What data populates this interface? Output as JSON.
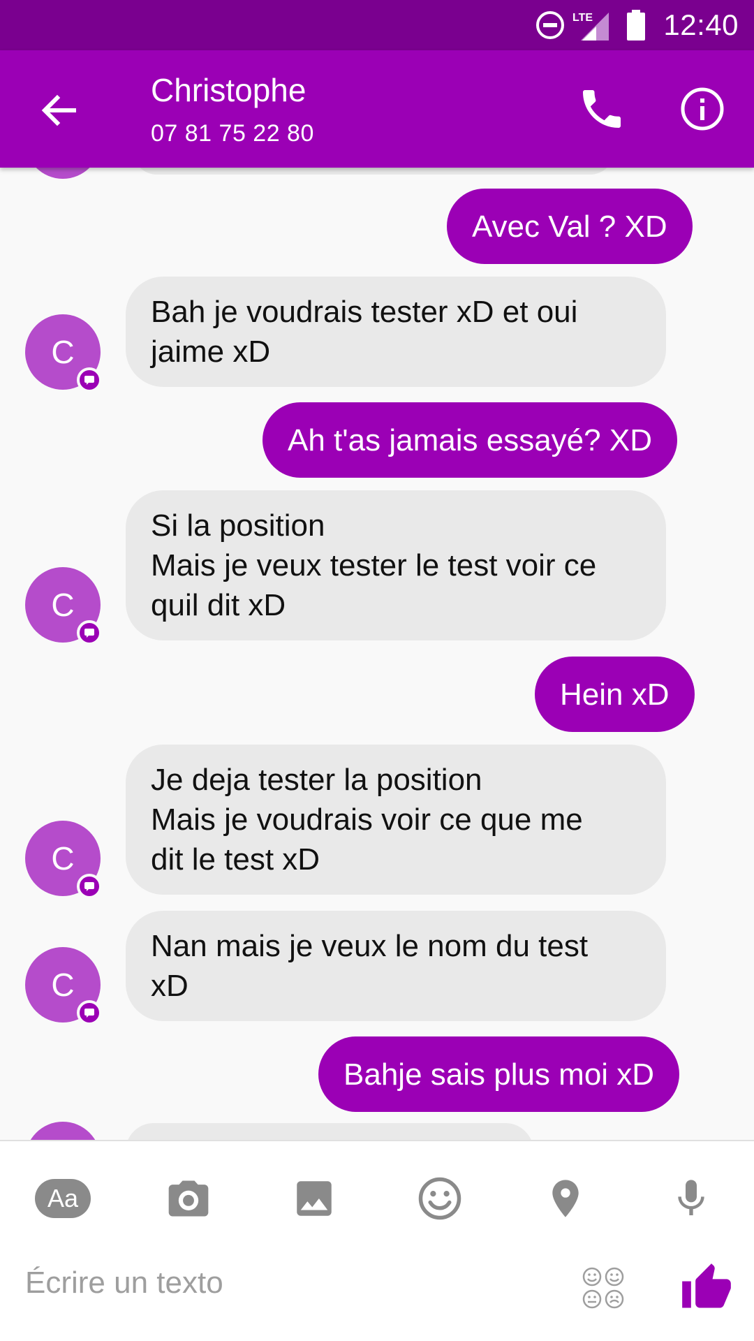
{
  "status_bar": {
    "time": "12:40",
    "network": "LTE"
  },
  "header": {
    "title": "Christophe",
    "subtitle": "07 81 75 22 80"
  },
  "colors": {
    "accent": "#9b00b5",
    "status_bar": "#7a008f",
    "incoming_bubble": "#e9e9e9",
    "avatar": "#b54ccb"
  },
  "messages": [
    {
      "direction": "out",
      "text": "Avec Val ? XD"
    },
    {
      "direction": "in",
      "avatar": "C",
      "text": "Bah je voudrais tester xD et oui\njaime xD"
    },
    {
      "direction": "out",
      "text": "Ah t'as jamais essayé? XD"
    },
    {
      "direction": "in",
      "avatar": "C",
      "text": "Si la position\nMais je veux tester le test voir ce\nquil dit xD"
    },
    {
      "direction": "out",
      "text": "Hein xD"
    },
    {
      "direction": "in",
      "avatar": "C",
      "text": "Je deja tester la position\nMais je voudrais voir ce que me\ndit le test xD"
    },
    {
      "direction": "in",
      "avatar": "C",
      "text": "Nan mais je veux le nom du test\nxD"
    },
    {
      "direction": "out",
      "text": "Bahje sais plus moi xD"
    }
  ],
  "composer": {
    "text_format_label": "Aa",
    "placeholder": "Écrire un texto",
    "tools": [
      "text-format-icon",
      "camera-icon",
      "gallery-icon",
      "emoji-icon",
      "location-icon",
      "microphone-icon"
    ]
  }
}
